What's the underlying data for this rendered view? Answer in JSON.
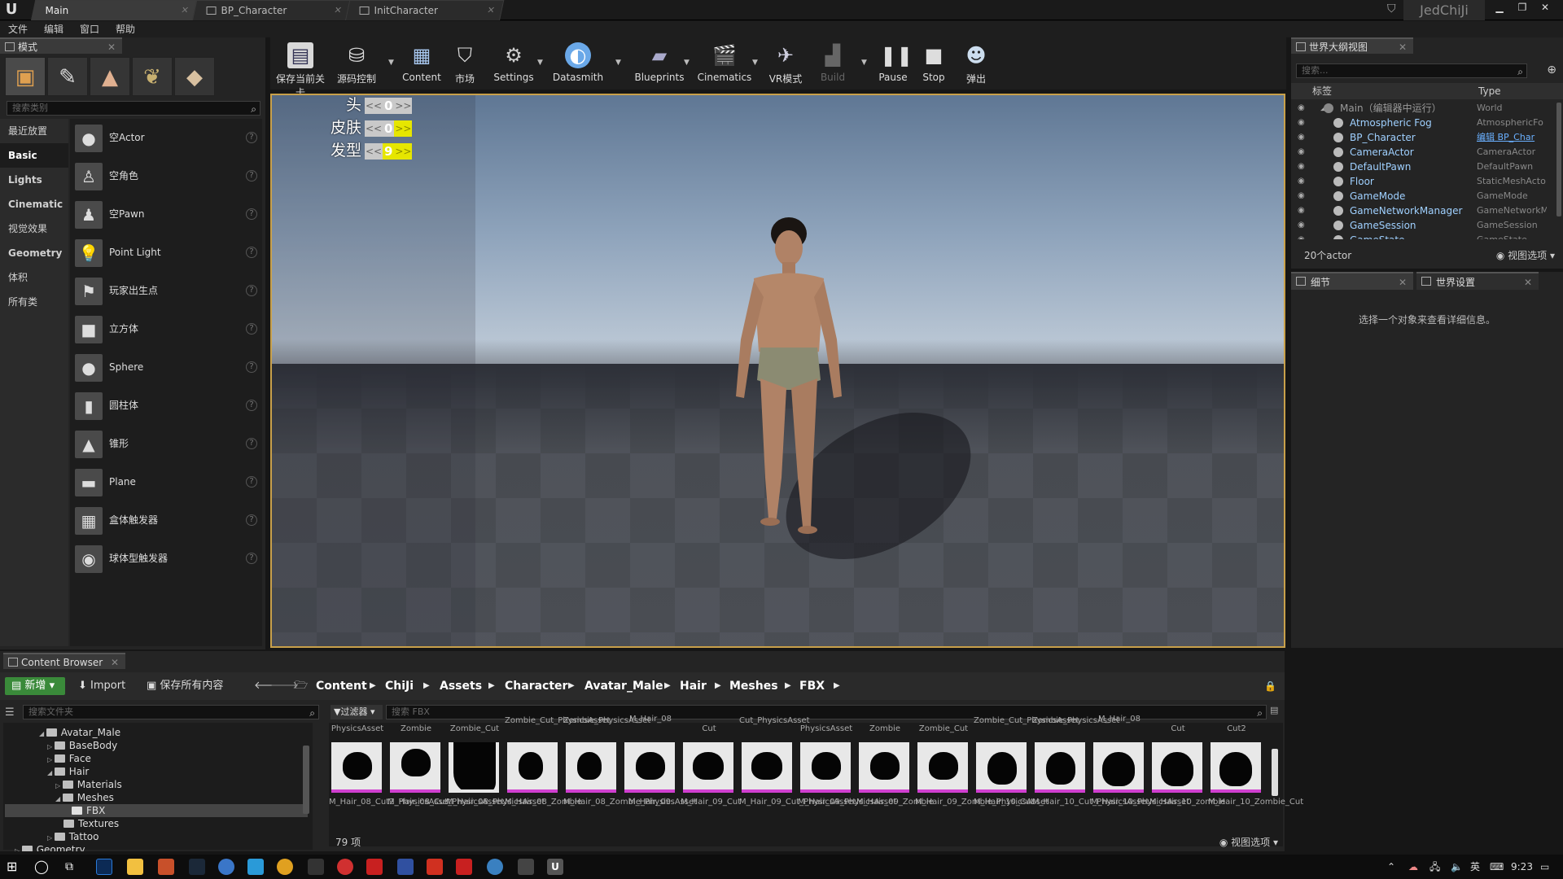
{
  "titlebar": {
    "tabs": [
      {
        "label": "Main"
      },
      {
        "label": "BP_Character"
      },
      {
        "label": "InitCharacter"
      }
    ],
    "user": "JedChiJi"
  },
  "menu": [
    "文件",
    "编辑",
    "窗口",
    "帮助"
  ],
  "modes": {
    "tab_label": "模式",
    "search_placeholder": "搜索类别",
    "categories": [
      "最近放置",
      "Basic",
      "Lights",
      "Cinematic",
      "视觉效果",
      "Geometry",
      "体积",
      "所有类"
    ],
    "selected_category": "Basic",
    "items": [
      "空Actor",
      "空角色",
      "空Pawn",
      "Point Light",
      "玩家出生点",
      "立方体",
      "Sphere",
      "圆柱体",
      "锥形",
      "Plane",
      "盒体触发器",
      "球体型触发器"
    ],
    "help": "?"
  },
  "toolbar": [
    {
      "label": "保存当前关卡",
      "icon": "save-icon"
    },
    {
      "label": "源码控制",
      "icon": "source-control-icon"
    },
    {
      "label": "Content",
      "icon": "content-icon"
    },
    {
      "label": "市场",
      "icon": "marketplace-icon"
    },
    {
      "label": "Settings",
      "icon": "settings-icon"
    },
    {
      "label": "Datasmith",
      "icon": "datasmith-icon"
    },
    {
      "label": "Blueprints",
      "icon": "blueprints-icon"
    },
    {
      "label": "Cinematics",
      "icon": "cinematics-icon"
    },
    {
      "label": "VR模式",
      "icon": "vr-icon"
    },
    {
      "label": "Build",
      "icon": "build-icon"
    },
    {
      "label": "Pause",
      "icon": "pause-icon"
    },
    {
      "label": "Stop",
      "icon": "stop-icon"
    },
    {
      "label": "弹出",
      "icon": "eject-icon"
    }
  ],
  "hud": {
    "rows": [
      {
        "label": "头",
        "prev": "<<",
        "value": "0",
        "next": ">>"
      },
      {
        "label": "皮肤",
        "prev": "<<",
        "value": "0",
        "next": ">>"
      },
      {
        "label": "发型",
        "prev": "<<",
        "value": "9",
        "next": ">>"
      }
    ]
  },
  "outliner": {
    "tab_label": "世界大纲视图",
    "search_placeholder": "搜索...",
    "col_label": "标签",
    "col_type": "Type",
    "root": {
      "name": "Main（编辑器中运行）",
      "type": "World"
    },
    "rows": [
      {
        "name": "Atmospheric Fog",
        "type": "AtmosphericFo"
      },
      {
        "name": "BP_Character",
        "type": "编辑 BP_Char"
      },
      {
        "name": "CameraActor",
        "type": "CameraActor"
      },
      {
        "name": "DefaultPawn",
        "type": "DefaultPawn"
      },
      {
        "name": "Floor",
        "type": "StaticMeshActo"
      },
      {
        "name": "GameMode",
        "type": "GameMode"
      },
      {
        "name": "GameNetworkManager",
        "type": "GameNetworkM"
      },
      {
        "name": "GameSession",
        "type": "GameSession"
      },
      {
        "name": "GameState",
        "type": "GameState"
      }
    ],
    "count": "20个actor",
    "view_options": "视图选项"
  },
  "details": {
    "tab_details": "细节",
    "tab_world": "世界设置",
    "hint": "选择一个对象来查看详细信息。"
  },
  "content_browser": {
    "tab_label": "Content Browser",
    "new_button": "新增",
    "import_button": "Import",
    "save_all_button": "保存所有内容",
    "breadcrumb": [
      "Content",
      "ChiJi",
      "Assets",
      "Character",
      "Avatar_Male",
      "Hair",
      "Meshes",
      "FBX"
    ],
    "folder_search_placeholder": "搜索文件夹",
    "filter_label": "过滤器",
    "asset_search_placeholder": "搜索 FBX",
    "tree": [
      {
        "label": "Avatar_Male",
        "depth": 2
      },
      {
        "label": "BaseBody",
        "depth": 3
      },
      {
        "label": "Face",
        "depth": 3
      },
      {
        "label": "Hair",
        "depth": 3
      },
      {
        "label": "Materials",
        "depth": 4
      },
      {
        "label": "Meshes",
        "depth": 4
      },
      {
        "label": "FBX",
        "depth": 5
      },
      {
        "label": "Textures",
        "depth": 4
      },
      {
        "label": "Tattoo",
        "depth": 3
      },
      {
        "label": "Geometry",
        "depth": 1
      }
    ],
    "top_row_labels": [
      "PhysicsAsset",
      "Zombie",
      "Zombie_Cut",
      "Zombie_Cut_PhysicsAsset",
      "Zombie_PhysicsAsset",
      "M_Hair_08",
      "Cut",
      "Cut_PhysicsAsset",
      "PhysicsAsset",
      "Zombie",
      "Zombie_Cut",
      "Zombie_Cut_PhysicsAsset",
      "Zombie_PhysicsAsset",
      "M_Hair_08",
      "Cut",
      "Cut2"
    ],
    "assets": [
      "M_Hair_08_Cut2_PhysicsAsset",
      "M_Hair_08_Cut_PhysicsAsset",
      "M_Hair_08_PhysicsAsset",
      "M_Hair_08_Zombie",
      "M_Hair_08_Zombie_PhysicsAsset",
      "M_Hair_09",
      "M_Hair_09_Cut",
      "M_Hair_09_Cut_PhysicsAsset",
      "M_Hair_09_PhysicsAsset",
      "M_Hair_09_Zombie",
      "M_Hair_09_Zombie_PhysicsAsset",
      "M_Hair_10_Cut",
      "M_Hair_10_Cut_PhysicsAsset",
      "M_Hair_10_PhysicsAsset",
      "M_Hair_10_zombie",
      "M_Hair_10_Zombie_Cut"
    ],
    "item_count": "79 项",
    "view_options": "视图选项"
  },
  "taskbar": {
    "ime": "英",
    "time": "9:23"
  }
}
